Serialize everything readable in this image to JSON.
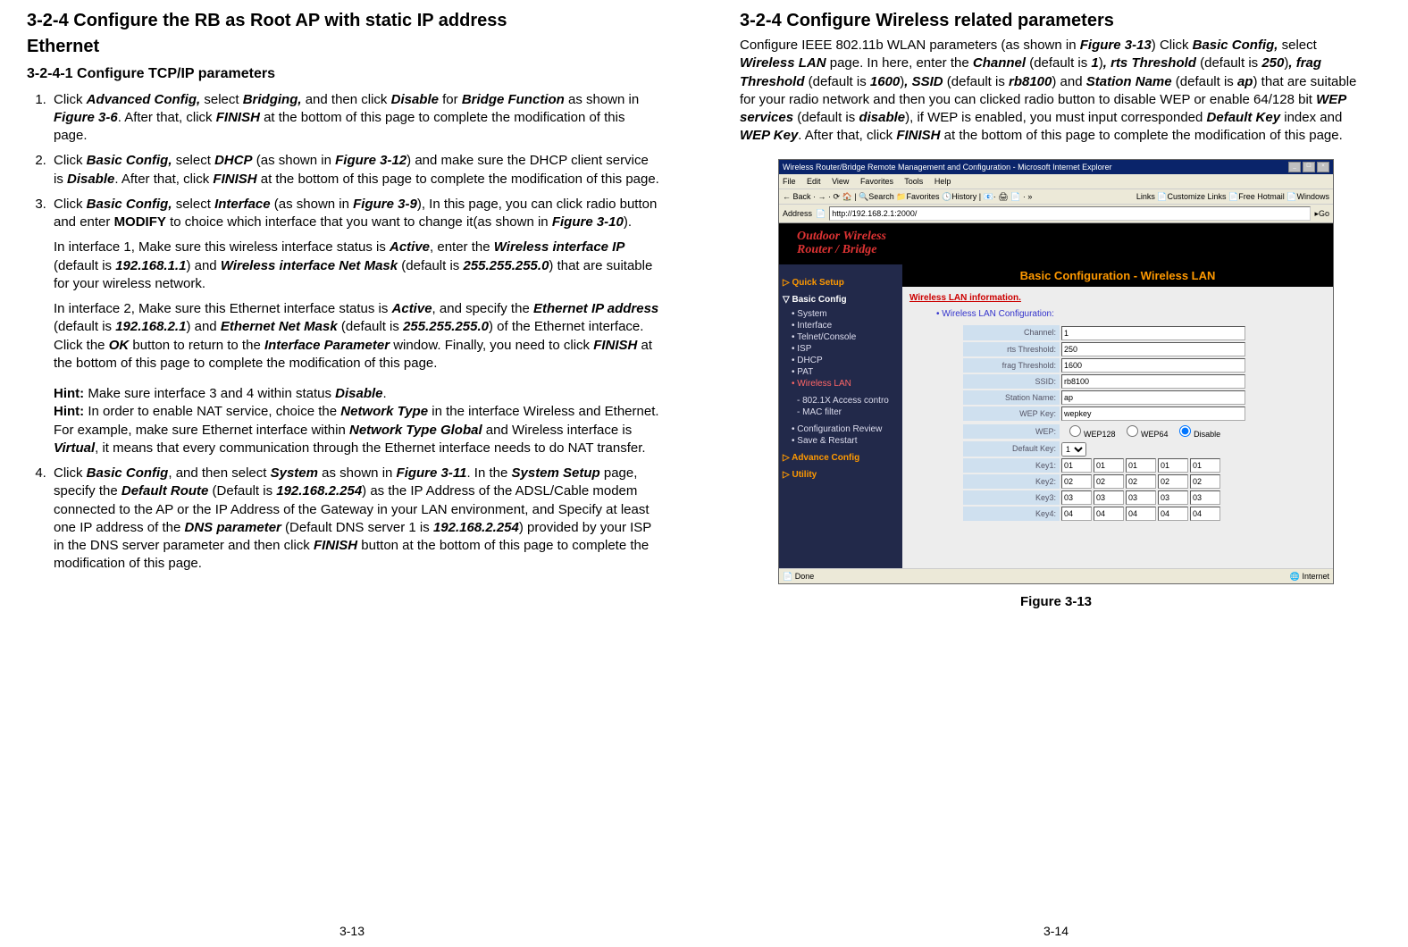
{
  "left_page": {
    "h2_a": "3-2-4 Configure the RB as Root AP with static IP address",
    "h2_b": "Ethernet",
    "h3": "3-2-4-1 Configure TCP/IP parameters",
    "items": {
      "1": {
        "pre1": "Click ",
        "b1": "Advanced Config,",
        "mid1": " select ",
        "b2": "Bridging,",
        "mid2": " and then click ",
        "b3": "Disable",
        "mid3": " for ",
        "b4": "Bridge Function",
        "mid4": " as shown in ",
        "b5": "Figure 3-6",
        "mid5": ". After that, click ",
        "b6": "FINISH",
        "tail": " at the bottom of this page to complete the modification of this page."
      },
      "2": {
        "pre1": "Click ",
        "b1": "Basic Config,",
        "mid1": " select ",
        "b2": "DHCP",
        "mid2": " (as shown in ",
        "b3": "Figure 3-12",
        "mid3": ") and make sure the DHCP client service is ",
        "b4": "Disable",
        "mid4": ". After that, click ",
        "b5": "FINISH",
        "tail": " at the bottom of this page to complete the modification of this page."
      },
      "3": {
        "p1": {
          "pre1": "Click ",
          "b1": "Basic Config,",
          "mid1": " select ",
          "b2": "Interface",
          "mid2": " (as shown in ",
          "b3": "Figure 3-9",
          "mid3": "), In this page, you can click radio button and enter ",
          "b4": "MODIFY",
          "mid4": " to choice which interface that you want to change it(as shown in ",
          "b5": "Figure 3-10",
          "tail": ")."
        },
        "p2": {
          "pre": "In interface 1, Make sure this wireless interface status is ",
          "b1": "Active",
          "mid1": ", enter the ",
          "b2": "Wireless interface IP",
          "mid2": " (default is ",
          "b3": "192.168.1.1",
          "mid3": ") and ",
          "b4": "Wireless interface Net Mask",
          "mid4": " (default is ",
          "b5": "255.255.255.0",
          "tail": ") that are suitable for your wireless network."
        },
        "p3": {
          "pre": "In interface 2, Make sure this Ethernet interface status is ",
          "b1": "Active",
          "mid1": ", and specify the ",
          "b2": "Ethernet IP address",
          "mid2": " (default is ",
          "b3": "192.168.2.1",
          "mid3": ") and ",
          "b4": "Ethernet Net Mask",
          "mid4": " (default is ",
          "b5": "255.255.255.0",
          "mid5": ") of the Ethernet interface."
        },
        "p3b": {
          "pre": "Click the ",
          "b1": "OK",
          "mid1": " button to return to the ",
          "b2": "Interface Parameter",
          "mid2": " window. Finally, you need to click ",
          "b3": "FINISH",
          "tail": " at the bottom of this page to complete the modification of this page."
        },
        "p4": {
          "b1": "Hint:",
          "mid1": " Make sure interface 3 and 4 within status ",
          "b2": "Disable",
          "tail": "."
        },
        "p5": {
          "b1": "Hint:",
          "mid1": " In order to enable NAT service, choice the ",
          "b2": "Network Type",
          "mid2": " in the interface Wireless and Ethernet. For example, make sure Ethernet interface within ",
          "b3": "Network Type Global",
          "mid3": " and Wireless interface is ",
          "b4": "Virtual",
          "tail": ", it means that every communication through the Ethernet interface needs to do NAT transfer."
        }
      },
      "4": {
        "pre": "Click ",
        "b1": "Basic Config",
        "mid1": ", and then select ",
        "b2": "System",
        "mid2": " as shown in ",
        "b3": "Figure 3-11",
        "mid3": ". In the ",
        "b4": "System Setup",
        "mid4": " page, specify the ",
        "b5": "Default Route",
        "mid5": " (Default is ",
        "b6": "192.168.2.254",
        "mid6": ") as the IP Address of the ADSL/Cable modem connected to the AP or the IP Address of the Gateway in your LAN environment, and Specify at least one IP address of the ",
        "b7": "DNS parameter",
        "mid7": " (Default DNS server 1 is ",
        "b8": "192.168.2.254",
        "mid8": ") provided by your ISP in the DNS server parameter and then click ",
        "b9": "FINISH",
        "tail": " button at the bottom of this page to complete the modification of this page."
      }
    },
    "page_num": "3-13"
  },
  "right_page": {
    "h2": "3-2-4 Configure Wireless related parameters",
    "para": {
      "pre": "Configure IEEE 802.11b WLAN parameters (as shown in ",
      "b1": "Figure 3-13",
      "mid1": ") Click ",
      "b2": "Basic Config,",
      "mid2": " select ",
      "b3": "Wireless LAN",
      "mid3": " page. In here, enter the ",
      "b4": "Channel",
      "mid4": " (default is ",
      "b5": "1",
      "mid5": ")",
      "b6": ", rts Threshold",
      "mid6": " (default is ",
      "b7": "250",
      "mid7": ")",
      "b8": ", frag Threshold",
      "mid8": " (default is ",
      "b9": "1600",
      "mid9": ")",
      "b10": ", SSID",
      "mid10": " (default is ",
      "b11": "rb8100",
      "mid11": ") and ",
      "b12": "Station Name",
      "mid12": " (default is ",
      "b13": "ap",
      "mid13": ") that are suitable for your radio network and then you can clicked radio button to disable WEP or enable 64/128 bit ",
      "b14": "WEP services",
      "mid14": " (default is ",
      "b15": "disable",
      "mid15": "), if WEP is enabled, you must input corresponded ",
      "b16": "Default Key",
      "mid16": " index and ",
      "b17": "WEP Key",
      "mid17": ". After that, click ",
      "b18": "FINISH",
      "tail": " at the bottom of this page to complete the modification of this page."
    },
    "figure_caption": "Figure 3-13",
    "page_num": "3-14",
    "screenshot": {
      "window_title": "Wireless Router/Bridge Remote Management and Configuration - Microsoft Internet Explorer",
      "menus": [
        "File",
        "Edit",
        "View",
        "Favorites",
        "Tools",
        "Help"
      ],
      "toolbar_left": "← Back  ·  →  ·  ⟳  🏠   | 🔍Search  📁Favorites  🕓History  | 📧· 🖨 📄 · »",
      "toolbar_right": "Links 📄Customize Links  📄Free Hotmail  📄Windows",
      "address_label": "Address",
      "address_value": "http://192.168.2.1:2000/",
      "go_label": "Go",
      "brand_line1": "Outdoor Wireless",
      "brand_line2": "Router / Bridge",
      "content_title": "Basic Configuration - Wireless LAN",
      "sidebar": {
        "quick": "▷ Quick Setup",
        "basic": "▽ Basic Config",
        "basic_items": [
          "System",
          "Interface",
          "Telnet/Console",
          "ISP",
          "DHCP",
          "PAT"
        ],
        "wlan": "Wireless LAN",
        "wlan_sub": [
          "802.1X Access contro",
          "MAC filter"
        ],
        "conf_items": [
          "Configuration Review",
          "Save & Restart"
        ],
        "advance": "▷ Advance Config",
        "utility": "▷ Utility"
      },
      "wlan_info": "Wireless LAN information.",
      "wlan_conf_link": "• Wireless LAN Configuration:",
      "form": {
        "channel_label": "Channel:",
        "channel": "1",
        "rts_label": "rts Threshold:",
        "rts": "250",
        "frag_label": "frag Threshold:",
        "frag": "1600",
        "ssid_label": "SSID:",
        "ssid": "rb8100",
        "station_label": "Station Name:",
        "station": "ap",
        "wepkey_label": "WEP Key:",
        "wepkey": "wepkey",
        "wep_label": "WEP:",
        "wep_opt1": "WEP128",
        "wep_opt2": "WEP64",
        "wep_opt3": "Disable",
        "defkey_label": "Default Key:",
        "defkey": "1",
        "key1_label": "Key1:",
        "key1": [
          "01",
          "01",
          "01",
          "01",
          "01"
        ],
        "key2_label": "Key2:",
        "key2": [
          "02",
          "02",
          "02",
          "02",
          "02"
        ],
        "key3_label": "Key3:",
        "key3": [
          "03",
          "03",
          "03",
          "03",
          "03"
        ],
        "key4_label": "Key4:",
        "key4": [
          "04",
          "04",
          "04",
          "04",
          "04"
        ]
      },
      "status_left": "Done",
      "status_right": "🌐 Internet"
    }
  }
}
